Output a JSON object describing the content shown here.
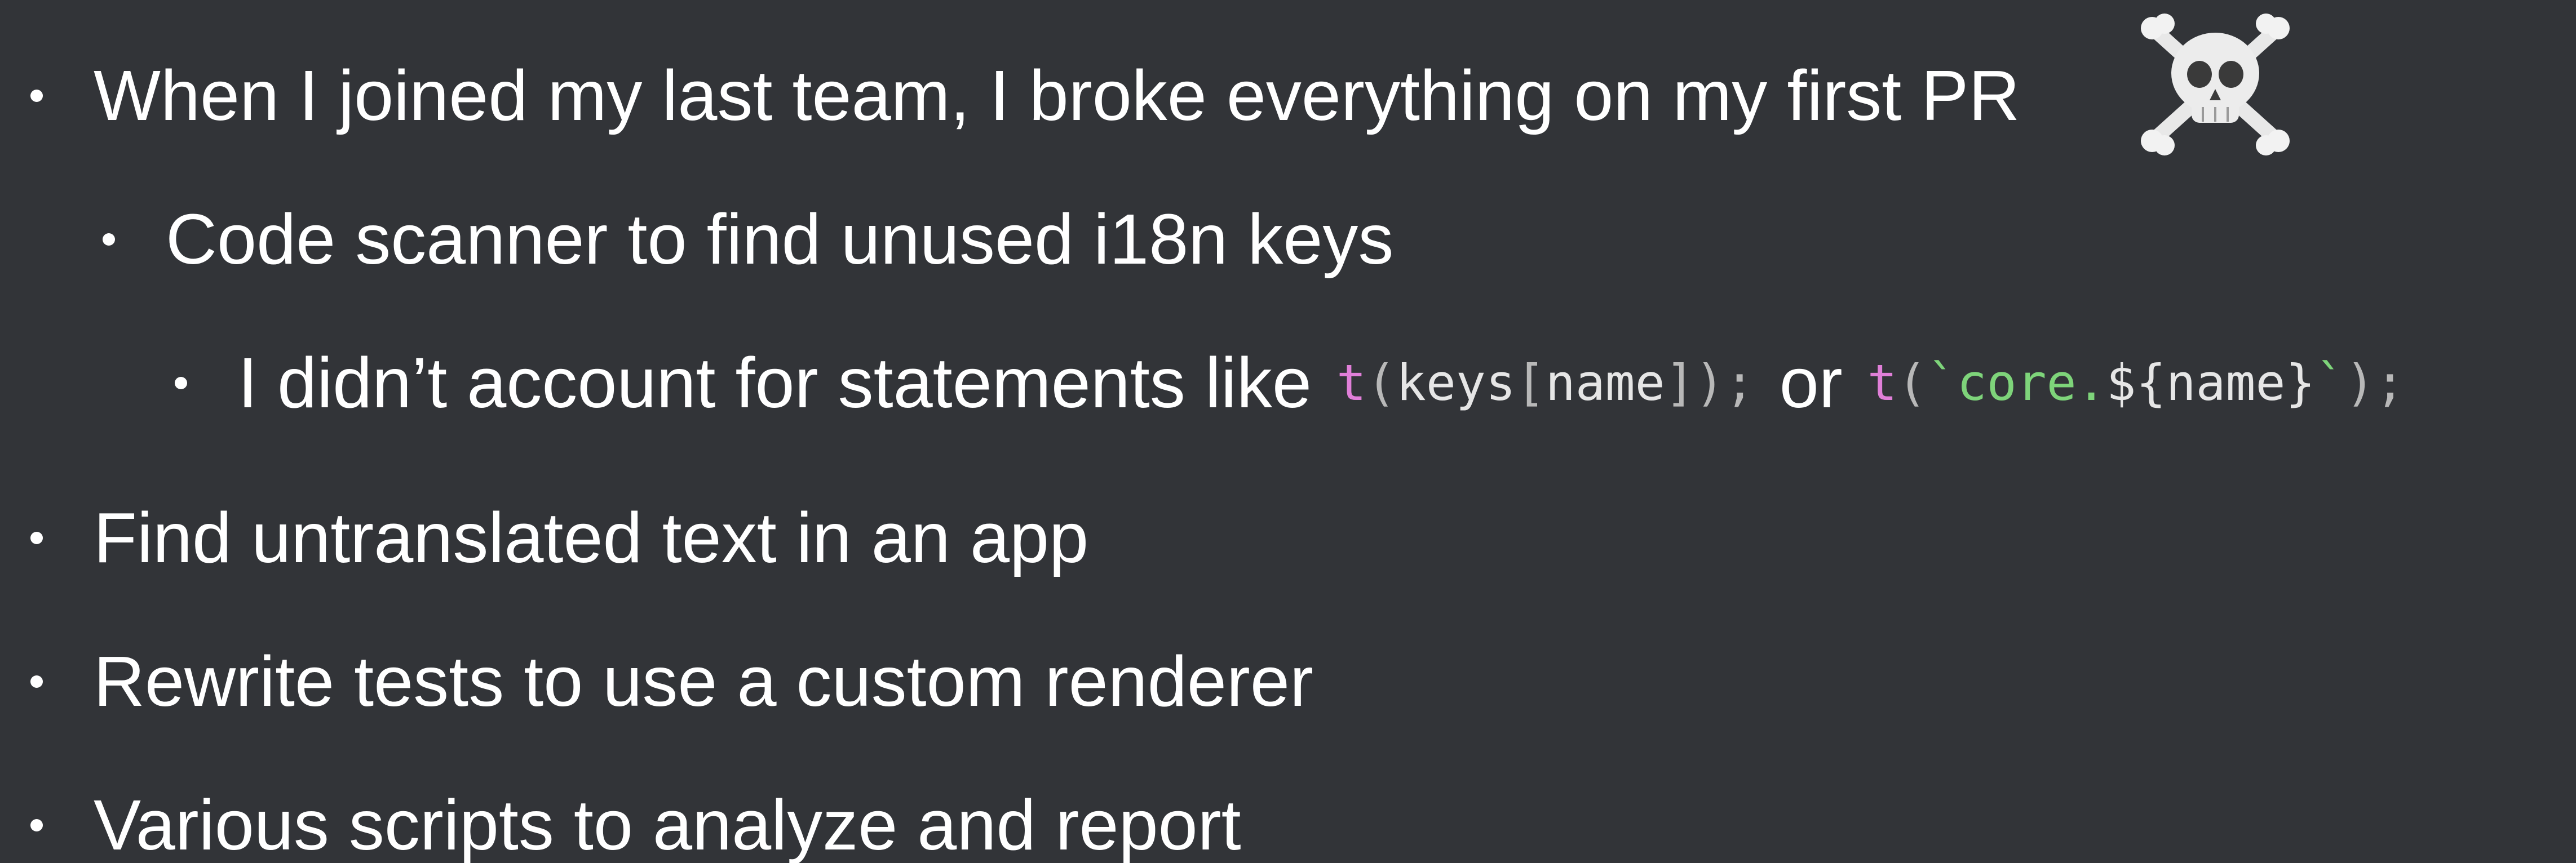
{
  "bullets": {
    "b1": "When I joined my last team, I broke everything on my first PR",
    "b2": "Code scanner to find unused i18n keys",
    "b3_prefix": "I didn’t account for statements like",
    "b3_or": "or",
    "b4": "Find untranslated text in an app",
    "b5": "Rewrite tests to use a custom renderer",
    "b6": "Various scripts to analyze and report"
  },
  "code1": {
    "fn": "t",
    "open": "(",
    "ident1": "keys",
    "bracket_open": "[",
    "ident2": "name",
    "bracket_close": "]",
    "close": ");"
  },
  "code2": {
    "fn": "t",
    "open": "(",
    "tick_open": "`",
    "str": "core.",
    "interp": "${name}",
    "tick_close": "`",
    "close": ");"
  },
  "icons": {
    "emoji": "skull-and-crossbones-icon"
  },
  "colors": {
    "background": "#323438",
    "text": "#ffffff",
    "code_fn": "#e07fd8",
    "code_string": "#7ed47a"
  }
}
